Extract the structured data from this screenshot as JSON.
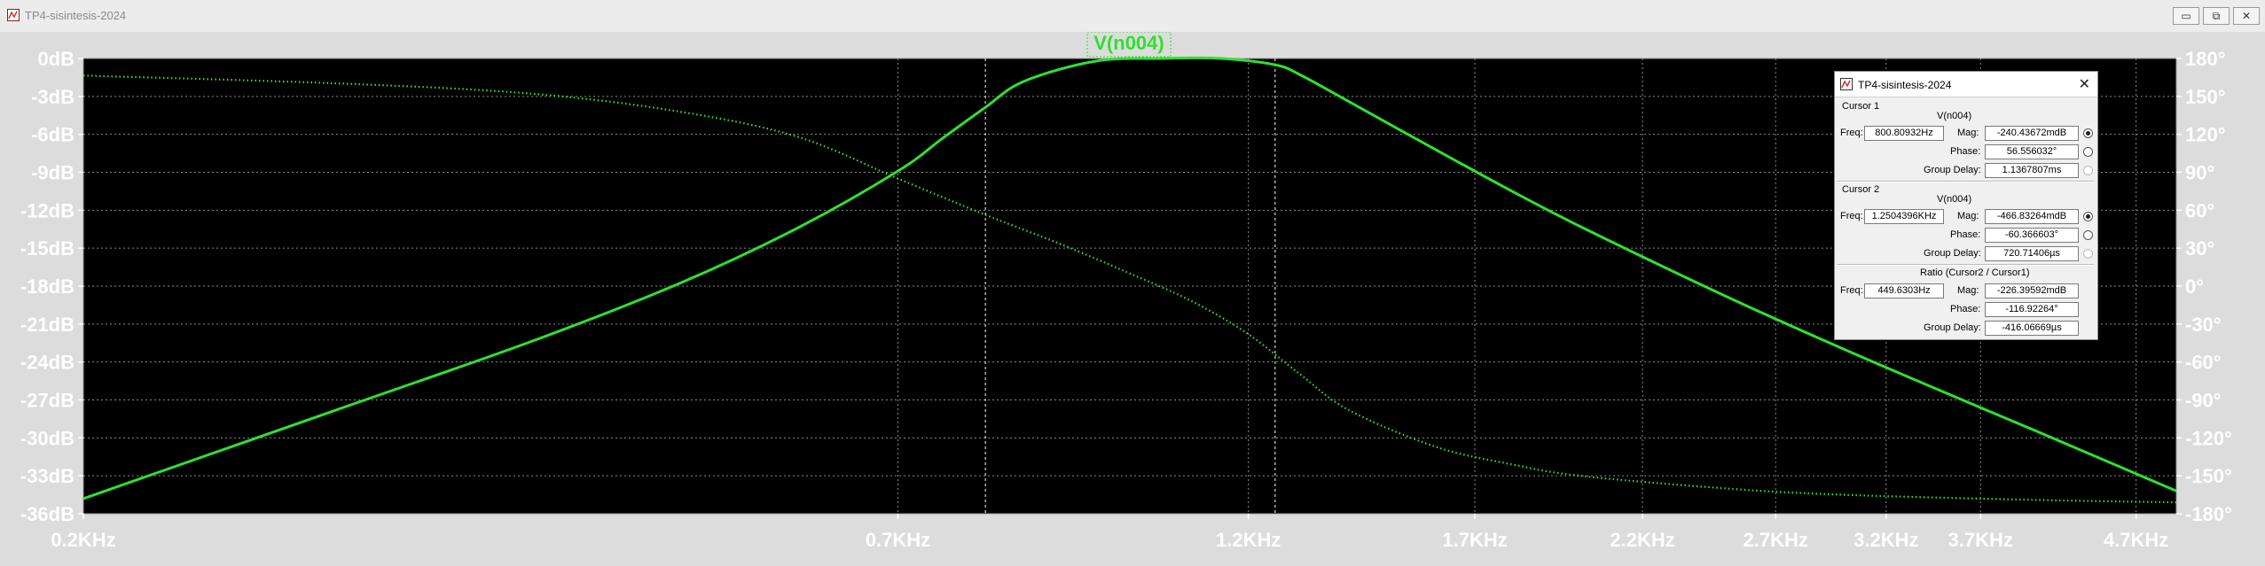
{
  "window": {
    "title": "TP4-sisintesis-2024",
    "buttons": {
      "minimize": "▭",
      "restore": "⧉",
      "close": "✕"
    }
  },
  "plot": {
    "trace_label": "V(n004)",
    "colors": {
      "trace": "#2fe02f",
      "background": "#000000",
      "grid": "#8a8a8a"
    }
  },
  "chart_data": {
    "type": "line",
    "x_scale": "log",
    "xlim": [
      200,
      5000
    ],
    "ylim_left": [
      -36,
      0
    ],
    "ylim_right": [
      -180,
      180
    ],
    "grid": true,
    "x_ticks": [
      "0.2KHz",
      "0.7KHz",
      "1.2KHz",
      "1.7KHz",
      "2.2KHz",
      "2.7KHz",
      "3.2KHz",
      "3.7KHz",
      "4.7KHz"
    ],
    "y_ticks_left": [
      "0dB",
      "-3dB",
      "-6dB",
      "-9dB",
      "-12dB",
      "-15dB",
      "-18dB",
      "-21dB",
      "-24dB",
      "-27dB",
      "-30dB",
      "-33dB",
      "-36dB"
    ],
    "y_ticks_right": [
      "180°",
      "150°",
      "120°",
      "90°",
      "60°",
      "30°",
      "0°",
      "-30°",
      "-60°",
      "-90°",
      "-120°",
      "-150°",
      "-180°"
    ],
    "cursor_freqs": [
      800.80932,
      1250.4396
    ],
    "series": [
      {
        "name": "V(n004)",
        "style": "solid",
        "axis": "left",
        "x": [
          200,
          300,
          400,
          500,
          600,
          700,
          750,
          800,
          850,
          950,
          1050,
          1150,
          1250,
          1300,
          1400,
          1600,
          1800,
          2000,
          2500,
          3000,
          3500,
          4000,
          5000
        ],
        "y": [
          -34.8,
          -27.5,
          -22.3,
          -17.8,
          -13.4,
          -8.9,
          -6.3,
          -3.9,
          -1.8,
          -0.2,
          0.0,
          0.0,
          -0.5,
          -1.3,
          -3.4,
          -7.2,
          -10.5,
          -13.3,
          -18.8,
          -23.0,
          -26.4,
          -29.3,
          -34.2
        ]
      },
      {
        "name": "Phase",
        "style": "dotted",
        "axis": "right",
        "x": [
          200,
          300,
          400,
          500,
          600,
          700,
          800,
          900,
          1000,
          1100,
          1200,
          1300,
          1400,
          1600,
          1800,
          2000,
          2500,
          3000,
          4000,
          5000
        ],
        "y": [
          166.5,
          160,
          152,
          138,
          118,
          85,
          56.6,
          33,
          10,
          -12,
          -38,
          -70,
          -98,
          -127,
          -141,
          -150,
          -160,
          -165,
          -169,
          -171
        ]
      }
    ]
  },
  "cursor_dialog": {
    "title": "TP4-sisintesis-2024",
    "close": "✕",
    "cursor1": {
      "header": "Cursor 1",
      "trace": "V(n004)",
      "freq_label": "Freq:",
      "freq": "800.80932Hz",
      "mag_label": "Mag:",
      "mag": "-240.43672mdB",
      "phase_label": "Phase:",
      "phase": "56.556032°",
      "gd_label": "Group Delay:",
      "group_delay": "1.1367807ms"
    },
    "cursor2": {
      "header": "Cursor 2",
      "trace": "V(n004)",
      "freq_label": "Freq:",
      "freq": "1.2504396KHz",
      "mag_label": "Mag:",
      "mag": "-466.83264mdB",
      "phase_label": "Phase:",
      "phase": "-60.366603°",
      "gd_label": "Group Delay:",
      "group_delay": "720.71406µs"
    },
    "ratio": {
      "header": "Ratio (Cursor2 / Cursor1)",
      "freq_label": "Freq:",
      "freq": "449.6303Hz",
      "mag_label": "Mag:",
      "mag": "-226.39592mdB",
      "phase_label": "Phase:",
      "phase": "-116.92264°",
      "gd_label": "Group Delay:",
      "group_delay": "-416.06669µs"
    }
  }
}
